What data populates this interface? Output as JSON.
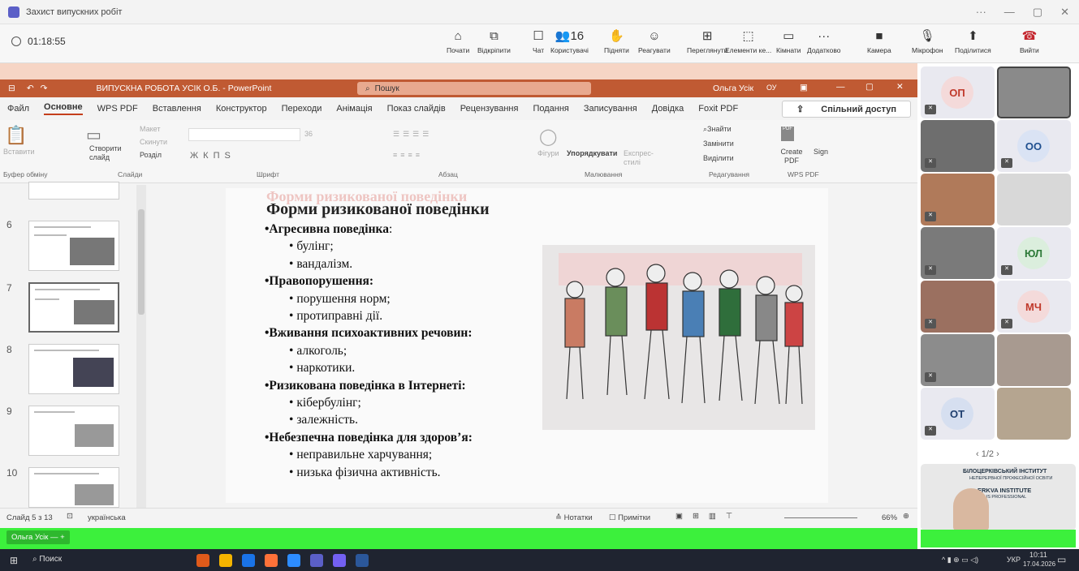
{
  "teams": {
    "title": "Захист випускних робіт",
    "timer": "01:18:55",
    "buttons": [
      {
        "icon": "⌂",
        "label": "Почати"
      },
      {
        "icon": "⧉",
        "label": "Відкріпити"
      },
      {
        "icon": "☐",
        "label": "Чат"
      },
      {
        "icon": "👥16",
        "label": "Користувачі"
      },
      {
        "icon": "✋",
        "label": "Підняти"
      },
      {
        "icon": "☺",
        "label": "Реагувати"
      },
      {
        "icon": "⊞",
        "label": "Переглянути"
      },
      {
        "icon": "⬚",
        "label": "Елементи ке..."
      },
      {
        "icon": "▭",
        "label": "Кімнати"
      },
      {
        "icon": "···",
        "label": "Додатково"
      },
      {
        "icon": "■",
        "label": "Камера"
      },
      {
        "icon": "🎙",
        "label": "Мікрофон"
      },
      {
        "icon": "⬆",
        "label": "Поділитися"
      },
      {
        "icon": "☎",
        "label": "Вийти"
      }
    ]
  },
  "ppt": {
    "title": "ВИПУСКНА РОБОТА УСІК О.Б. - PowerPoint",
    "search": "Пошук",
    "user": "Ольга Усік",
    "initials": "ОУ",
    "menu": [
      "Файл",
      "Основне",
      "WPS PDF",
      "Вставлення",
      "Конструктор",
      "Переходи",
      "Анімація",
      "Показ слайдів",
      "Рецензування",
      "Подання",
      "Записування",
      "Довідка",
      "Foxit PDF"
    ],
    "share": "Спільний доступ",
    "ribbon": {
      "paste": "Вставити",
      "create": "Створити слайд",
      "layout": "Макет",
      "reset": "Скинути",
      "section": "Розділ",
      "size": "36",
      "shapes": "Фігури",
      "arrange": "Упорядкувати",
      "styles": "Експрес-стилі",
      "find": "Знайти",
      "replace": "Замінити",
      "select": "Виділити",
      "create_pdf": "Create PDF",
      "sign": "Sign",
      "groups": [
        "Буфер обміну",
        "Слайди",
        "Шрифт",
        "Абзац",
        "Малювання",
        "Редагування",
        "WPS PDF"
      ]
    },
    "thumbs": [
      "6",
      "7",
      "8",
      "9",
      "10"
    ],
    "slide": {
      "ghost_title": "Форми ризикованої поведінки",
      "title": "Форми ризикованої поведінки",
      "items": [
        {
          "h": "•Агресивна поведінка",
          "suffix": ":",
          "subs": [
            "булінг;",
            "вандалізм."
          ]
        },
        {
          "h": "•Правопорушення:",
          "suffix": "",
          "subs": [
            "порушення норм;",
            "протиправні дії."
          ]
        },
        {
          "h": "•Вживання психоактивних речовин:",
          "suffix": "",
          "subs": [
            "алкоголь;",
            "наркотики."
          ]
        },
        {
          "h": "•Ризикована поведінка в Інтернеті:",
          "suffix": "",
          "subs": [
            "кібербулінг;",
            "залежність."
          ]
        },
        {
          "h": "•Небезпечна поведінка для здоров’я:",
          "suffix": "",
          "subs": [
            "неправильне харчування;",
            "низька фізична активність."
          ]
        }
      ]
    },
    "status": {
      "slide": "Слайд 5 з 13",
      "lang": "українська",
      "notes": "Нотатки",
      "comments": "Примітки",
      "zoom": "66%"
    },
    "green_name": "Ольга Усік"
  },
  "gallery": {
    "tiles": [
      {
        "initials": "ОП",
        "color": "#c0392b"
      },
      {
        "initials": "ОО",
        "color": "#1f4f8f"
      },
      {
        "initials": "ЮЛ",
        "color": "#2d7a38"
      },
      {
        "initials": "МЧ",
        "color": "#c0392b"
      },
      {
        "initials": "ОТ",
        "color": "#1f3f6f"
      }
    ],
    "page": "1/2",
    "inst_line1": "БІЛОЦЕРКІВСЬКИЙ ІНСТИТУТ",
    "inst_line2": "НЕПЕРЕРВНОЇ ПРОФЕСІЙНОЇ ОСВІТИ",
    "inst_line3": "ERKVA INSTITUTE",
    "inst_line4": "UOUS PROFESSIONAL"
  },
  "taskbar": {
    "search": "Поиск",
    "lang": "УКР",
    "time": "10:11",
    "date": "17.04.2026"
  }
}
